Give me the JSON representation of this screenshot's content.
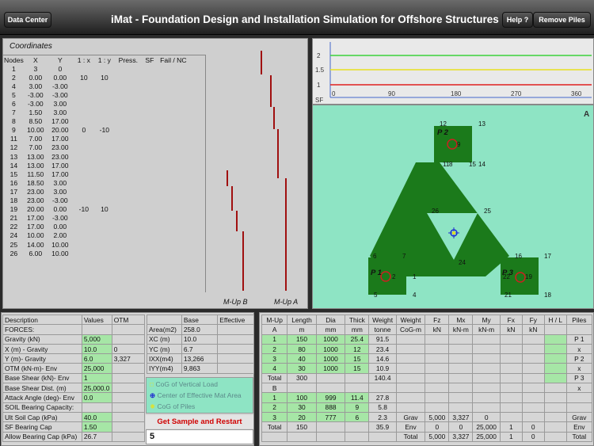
{
  "topbar": {
    "data_center": "Data Center",
    "title": "iMat - Foundation Design and Installation Simulation for Offshore Structures",
    "help": "Help ?",
    "remove_piles": "Remove Piles"
  },
  "coords": {
    "title": "Coordinates",
    "headers": [
      "Nodes",
      "X",
      "Y",
      "1 : x",
      "1 : y",
      "Press.",
      "SF",
      "Fail / NC"
    ],
    "rows": [
      [
        "1",
        "3",
        "0",
        "",
        "",
        "",
        "",
        ""
      ],
      [
        "2",
        "0.00",
        "0.00",
        "10",
        "10",
        "",
        "",
        ""
      ],
      [
        "4",
        "3.00",
        "-3.00",
        "",
        "",
        "",
        "",
        ""
      ],
      [
        "5",
        "-3.00",
        "-3.00",
        "",
        "",
        "",
        "",
        ""
      ],
      [
        "6",
        "-3.00",
        "3.00",
        "",
        "",
        "",
        "",
        ""
      ],
      [
        "7",
        "1.50",
        "3.00",
        "",
        "",
        "",
        "",
        ""
      ],
      [
        "8",
        "8.50",
        "17.00",
        "",
        "",
        "",
        "",
        ""
      ],
      [
        "9",
        "10.00",
        "20.00",
        "0",
        "-10",
        "",
        "",
        ""
      ],
      [
        "11",
        "7.00",
        "17.00",
        "",
        "",
        "",
        "",
        ""
      ],
      [
        "12",
        "7.00",
        "23.00",
        "",
        "",
        "",
        "",
        ""
      ],
      [
        "13",
        "13.00",
        "23.00",
        "",
        "",
        "",
        "",
        ""
      ],
      [
        "14",
        "13.00",
        "17.00",
        "",
        "",
        "",
        "",
        ""
      ],
      [
        "15",
        "11.50",
        "17.00",
        "",
        "",
        "",
        "",
        ""
      ],
      [
        "16",
        "18.50",
        "3.00",
        "",
        "",
        "",
        "",
        ""
      ],
      [
        "17",
        "23.00",
        "3.00",
        "",
        "",
        "",
        "",
        ""
      ],
      [
        "18",
        "23.00",
        "-3.00",
        "",
        "",
        "",
        "",
        ""
      ],
      [
        "19",
        "20.00",
        "0.00",
        "-10",
        "10",
        "",
        "",
        ""
      ],
      [
        "21",
        "17.00",
        "-3.00",
        "",
        "",
        "",
        "",
        ""
      ],
      [
        "22",
        "17.00",
        "0.00",
        "",
        "",
        "",
        "",
        ""
      ],
      [
        "24",
        "10.00",
        "2.00",
        "",
        "",
        "",
        "",
        ""
      ],
      [
        "25",
        "14.00",
        "10.00",
        "",
        "",
        "",
        "",
        ""
      ],
      [
        "26",
        "6.00",
        "10.00",
        "",
        "",
        "",
        "",
        ""
      ]
    ],
    "mup_b": "M-Up B",
    "mup_a": "M-Up A"
  },
  "polar": {
    "yticks": [
      "2",
      "1.5",
      "1",
      "SF"
    ],
    "xticks": [
      "0",
      "90",
      "180",
      "270",
      "360"
    ]
  },
  "map": {
    "nodes": [
      {
        "id": "12",
        "t": "12"
      },
      {
        "id": "13",
        "t": "13"
      },
      {
        "id": "9",
        "t": "9"
      },
      {
        "id": "11",
        "t": "11"
      },
      {
        "id": "8",
        "t": "8"
      },
      {
        "id": "15",
        "t": "15"
      },
      {
        "id": "14",
        "t": "14"
      },
      {
        "id": "26",
        "t": "26"
      },
      {
        "id": "25",
        "t": "25"
      },
      {
        "id": "24",
        "t": "24"
      },
      {
        "id": "6",
        "t": "6"
      },
      {
        "id": "7",
        "t": "7"
      },
      {
        "id": "2",
        "t": "2"
      },
      {
        "id": "1",
        "t": "1"
      },
      {
        "id": "5",
        "t": "5"
      },
      {
        "id": "4",
        "t": "4"
      },
      {
        "id": "16",
        "t": "16"
      },
      {
        "id": "17",
        "t": "17"
      },
      {
        "id": "22",
        "t": "22"
      },
      {
        "id": "19",
        "t": "19"
      },
      {
        "id": "21",
        "t": "21"
      },
      {
        "id": "18",
        "t": "18"
      }
    ],
    "piles": [
      "P 2",
      "P 1",
      "P 3"
    ],
    "north": "A"
  },
  "desc": {
    "headers": [
      "Description",
      "Values",
      "OTM"
    ],
    "rows": [
      [
        "FORCES:",
        "",
        ""
      ],
      [
        "Gravity (kN)",
        "5,000",
        ""
      ],
      [
        "X (m) - Gravity",
        "10.0",
        "0"
      ],
      [
        "Y (m)- Gravity",
        "6.0",
        "3,327"
      ],
      [
        "OTM (kN-m)- Env",
        "25,000",
        ""
      ],
      [
        "Base Shear (kN)- Env",
        "1",
        ""
      ],
      [
        "Base Shear Dist. (m)",
        "25,000.0",
        ""
      ],
      [
        "Attack Angle (deg)- Env",
        "0.0",
        ""
      ],
      [
        "SOIL Bearing Capacity:",
        "",
        ""
      ],
      [
        "Ult Soil Cap (kPa)",
        "40.0",
        ""
      ],
      [
        "SF Bearing Cap",
        "1.50",
        ""
      ],
      [
        "Allow Bearing Cap (kPa)",
        "26.7",
        ""
      ]
    ]
  },
  "base": {
    "headers": [
      "",
      "Base",
      "Effective"
    ],
    "rows": [
      [
        "Area(m2)",
        "258.0",
        ""
      ],
      [
        "XC (m)",
        "10.0",
        ""
      ],
      [
        "YC (m)",
        "6.7",
        ""
      ],
      [
        "IXX(m4)",
        "13,266",
        ""
      ],
      [
        "IYY(m4)",
        "9,863",
        ""
      ]
    ]
  },
  "legend": {
    "vertical": "CoG of Vertical Load",
    "effective": "Center of Effective Mat Area",
    "piles": "CoG of Piles"
  },
  "restart": "Get Sample and Restart",
  "input_value": "5",
  "mup": {
    "headers": [
      "M-Up",
      "Length",
      "Dia",
      "Thick",
      "Weight",
      "Weight",
      "Fz",
      "Mx",
      "My",
      "Fx",
      "Fy",
      "H / L",
      "Piles"
    ],
    "units": [
      "A",
      "m",
      "mm",
      "mm",
      "tonne",
      "CoG-m",
      "kN",
      "kN-m",
      "kN-m",
      "kN",
      "kN",
      "",
      ""
    ],
    "rows": [
      [
        "1",
        "150",
        "1000",
        "25.4",
        "91.5",
        "",
        "",
        "",
        "",
        "",
        "",
        "",
        "P 1"
      ],
      [
        "2",
        "80",
        "1000",
        "12",
        "23.4",
        "",
        "",
        "",
        "",
        "",
        "",
        "",
        "x"
      ],
      [
        "3",
        "40",
        "1000",
        "15",
        "14.6",
        "",
        "",
        "",
        "",
        "",
        "",
        "",
        "P 2"
      ],
      [
        "4",
        "30",
        "1000",
        "15",
        "10.9",
        "",
        "",
        "",
        "",
        "",
        "",
        "",
        "x"
      ],
      [
        "Total",
        "300",
        "",
        "",
        "140.4",
        "",
        "",
        "",
        "",
        "",
        "",
        "",
        "P 3"
      ],
      [
        "B",
        "",
        "",
        "",
        "",
        "",
        "",
        "",
        "",
        "",
        "",
        "",
        "x"
      ],
      [
        "1",
        "100",
        "999",
        "11.4",
        "27.8",
        "",
        "",
        "",
        "",
        "",
        "",
        "",
        ""
      ],
      [
        "2",
        "30",
        "888",
        "9",
        "5.8",
        "",
        "",
        "",
        "",
        "",
        "",
        "",
        ""
      ],
      [
        "3",
        "20",
        "777",
        "6",
        "2.3",
        "Grav",
        "5,000",
        "3,327",
        "0",
        "",
        "",
        "",
        "Grav"
      ],
      [
        "Total",
        "150",
        "",
        "",
        "35.9",
        "Env",
        "0",
        "0",
        "25,000",
        "1",
        "0",
        "",
        "Env"
      ],
      [
        "",
        "",
        "",
        "",
        "",
        "Total",
        "5,000",
        "3,327",
        "25,000",
        "1",
        "0",
        "",
        "Total"
      ]
    ]
  },
  "colors": {
    "accent_green": "#a6e6a6",
    "map_bg": "#8ee4c4",
    "mat": "#1b7a1b",
    "bar": "#a01010",
    "restart": "#d00000"
  }
}
